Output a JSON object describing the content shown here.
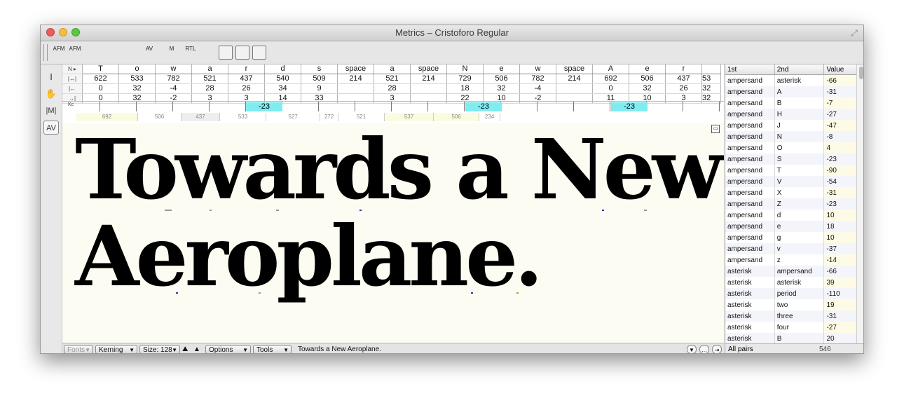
{
  "window": {
    "title": "Metrics – Cristoforo Regular"
  },
  "toolbar": {
    "items": [
      {
        "label": "AFM",
        "name": "open-afm-icon"
      },
      {
        "label": "AFM",
        "name": "save-afm-icon"
      },
      {
        "label": "",
        "name": "paste-icon"
      },
      {
        "label": "",
        "name": "kern-classes-icon"
      },
      {
        "label": "",
        "name": "kern-list-icon"
      },
      {
        "label": "AV",
        "name": "auto-kern-icon"
      },
      {
        "label": "M",
        "name": "metrics-icon"
      },
      {
        "label": "RTL",
        "name": "rtl-icon"
      },
      {
        "label": "",
        "name": "baseline-icon"
      },
      {
        "label": "",
        "name": "show-metrics-panel-icon"
      },
      {
        "label": "",
        "name": "show-preview-icon"
      },
      {
        "label": "",
        "name": "expand-icon"
      }
    ]
  },
  "tools": [
    {
      "label": "I",
      "name": "text-tool-icon"
    },
    {
      "label": "✋",
      "name": "hand-tool-icon"
    },
    {
      "label": "|M|",
      "name": "metrics-tool-icon"
    },
    {
      "label": "AV",
      "name": "kerning-tool-icon"
    }
  ],
  "metrics": {
    "row_labels": [
      "N ▸",
      "|↔|",
      "|←",
      "→|"
    ],
    "columns": [
      {
        "glyph": "T",
        "width": "622",
        "lsb": "0",
        "rsb": "0"
      },
      {
        "glyph": "o",
        "width": "533",
        "lsb": "32",
        "rsb": "32"
      },
      {
        "glyph": "w",
        "width": "782",
        "lsb": "-4",
        "rsb": "-2"
      },
      {
        "glyph": "a",
        "width": "521",
        "lsb": "28",
        "rsb": "3"
      },
      {
        "glyph": "r",
        "width": "437",
        "lsb": "26",
        "rsb": "3"
      },
      {
        "glyph": "d",
        "width": "540",
        "lsb": "34",
        "rsb": "14"
      },
      {
        "glyph": "s",
        "width": "509",
        "lsb": "9",
        "rsb": "33"
      },
      {
        "glyph": "space",
        "width": "214",
        "lsb": "",
        "rsb": ""
      },
      {
        "glyph": "a",
        "width": "521",
        "lsb": "28",
        "rsb": "3"
      },
      {
        "glyph": "space",
        "width": "214",
        "lsb": "",
        "rsb": ""
      },
      {
        "glyph": "N",
        "width": "729",
        "lsb": "18",
        "rsb": "22"
      },
      {
        "glyph": "e",
        "width": "506",
        "lsb": "32",
        "rsb": "10"
      },
      {
        "glyph": "w",
        "width": "782",
        "lsb": "-4",
        "rsb": "-2"
      },
      {
        "glyph": "space",
        "width": "214",
        "lsb": "",
        "rsb": ""
      },
      {
        "glyph": "A",
        "width": "692",
        "lsb": "0",
        "rsb": "11"
      },
      {
        "glyph": "e",
        "width": "506",
        "lsb": "32",
        "rsb": "10"
      },
      {
        "glyph": "r",
        "width": "437",
        "lsb": "26",
        "rsb": "3"
      },
      {
        "glyph": "",
        "width": "53",
        "lsb": "32",
        "rsb": "32"
      }
    ],
    "kern_label": "Kc",
    "kern_values": [
      "-23",
      "-23",
      "-23"
    ],
    "width_strip": [
      "692",
      "506",
      "437",
      "533",
      "527",
      "272",
      "521",
      "537",
      "506",
      "234"
    ]
  },
  "preview": {
    "line1": "Towards a New",
    "line2": "Aeroplane."
  },
  "statusbar": {
    "fonts": "Fonts",
    "kerning": "Kerning",
    "size": "Size: 128",
    "options": "Options",
    "tools": "Tools",
    "text": "Towards a New Aeroplane."
  },
  "kern_panel": {
    "headers": [
      "1st",
      "2nd",
      "Value"
    ],
    "rows": [
      [
        "ampersand",
        "asterisk",
        "-66"
      ],
      [
        "ampersand",
        "A",
        "-31"
      ],
      [
        "ampersand",
        "B",
        "-7"
      ],
      [
        "ampersand",
        "H",
        "-27"
      ],
      [
        "ampersand",
        "J",
        "-47"
      ],
      [
        "ampersand",
        "N",
        "-8"
      ],
      [
        "ampersand",
        "O",
        "4"
      ],
      [
        "ampersand",
        "S",
        "-23"
      ],
      [
        "ampersand",
        "T",
        "-90"
      ],
      [
        "ampersand",
        "V",
        "-54"
      ],
      [
        "ampersand",
        "X",
        "-31"
      ],
      [
        "ampersand",
        "Z",
        "-23"
      ],
      [
        "ampersand",
        "d",
        "10"
      ],
      [
        "ampersand",
        "e",
        "18"
      ],
      [
        "ampersand",
        "g",
        "10"
      ],
      [
        "ampersand",
        "v",
        "-37"
      ],
      [
        "ampersand",
        "z",
        "-14"
      ],
      [
        "asterisk",
        "ampersand",
        "-66"
      ],
      [
        "asterisk",
        "asterisk",
        "39"
      ],
      [
        "asterisk",
        "period",
        "-110"
      ],
      [
        "asterisk",
        "two",
        "19"
      ],
      [
        "asterisk",
        "three",
        "-31"
      ],
      [
        "asterisk",
        "four",
        "-27"
      ],
      [
        "asterisk",
        "B",
        "20"
      ]
    ],
    "footer_label": "All pairs",
    "footer_count": "546"
  }
}
